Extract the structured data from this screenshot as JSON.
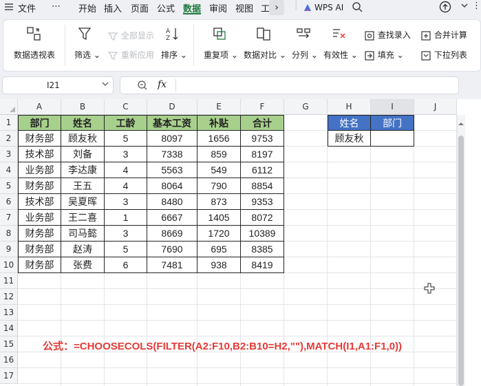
{
  "menubar": {
    "items": [
      "文件",
      "⋯",
      "开始",
      "插入",
      "页面",
      "公式",
      "数据",
      "审阅",
      "视图",
      "工"
    ],
    "active": "数据",
    "wps_ai": "WPS AI"
  },
  "ribbon": {
    "pivot": "数据透视表",
    "filter": "筛选",
    "show_all": "全部显示",
    "reapply": "重新应用",
    "sort": "排序",
    "duplicates": "重复项",
    "compare": "数据对比",
    "split": "分列",
    "validity": "有效性",
    "find_entry": "查找录入",
    "fill": "填充",
    "merge_calc": "合并计算",
    "dropdown_list": "下拉列表"
  },
  "formula_bar": {
    "cell_ref": "I21",
    "fx": "fx",
    "content": ""
  },
  "sheet": {
    "columns": [
      "A",
      "B",
      "C",
      "D",
      "E",
      "F",
      "G",
      "H",
      "I",
      "J"
    ],
    "rows": [
      "1",
      "2",
      "3",
      "4",
      "5",
      "6",
      "7",
      "8",
      "9",
      "10",
      "11",
      "12",
      "13",
      "14",
      "15",
      "16",
      "17"
    ],
    "table_header": [
      "部门",
      "姓名",
      "工龄",
      "基本工资",
      "补贴",
      "合计"
    ],
    "table_rows": [
      [
        "财务部",
        "顾友秋",
        "5",
        "8097",
        "1656",
        "9753"
      ],
      [
        "技术部",
        "刘备",
        "3",
        "7338",
        "859",
        "8197"
      ],
      [
        "业务部",
        "李达康",
        "4",
        "5563",
        "549",
        "6112"
      ],
      [
        "财务部",
        "王五",
        "4",
        "8064",
        "790",
        "8854"
      ],
      [
        "技术部",
        "吴夏晖",
        "3",
        "8480",
        "873",
        "9353"
      ],
      [
        "业务部",
        "王二喜",
        "1",
        "6667",
        "1405",
        "8072"
      ],
      [
        "财务部",
        "司马懿",
        "3",
        "8669",
        "1720",
        "10389"
      ],
      [
        "财务部",
        "赵涛",
        "5",
        "7690",
        "695",
        "8385"
      ],
      [
        "财务部",
        "张费",
        "6",
        "7481",
        "938",
        "8419"
      ]
    ],
    "lookup_header": [
      "姓名",
      "部门"
    ],
    "lookup_value": [
      "顾友秋",
      ""
    ],
    "formula_text": "公式：=CHOOSECOLS(FILTER(A2:F10,B2:B10=H2,\"\"),MATCH(I1,A1:F1,0))"
  },
  "colors": {
    "header_green": "#a8d08d",
    "lookup_blue": "#4472c4",
    "formula_red": "#e53935",
    "active_tab": "#1f7a3f"
  }
}
